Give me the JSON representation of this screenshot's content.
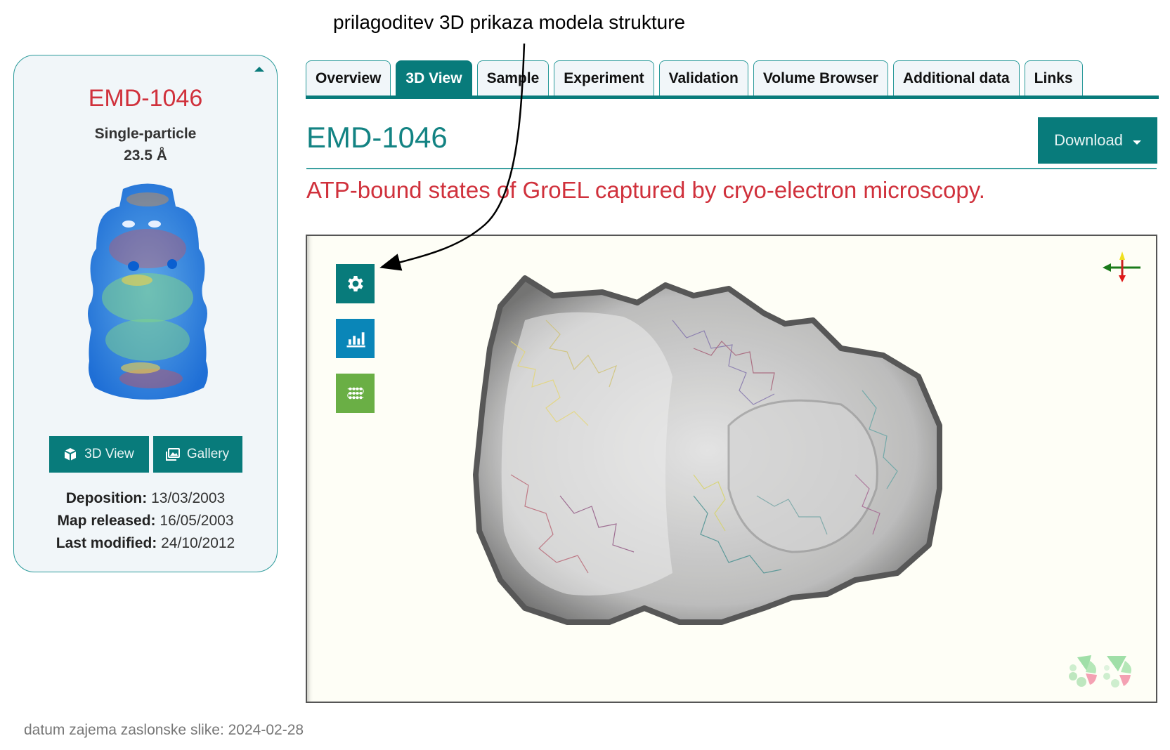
{
  "annotation": {
    "text": "prilagoditev 3D prikaza modela strukture"
  },
  "card": {
    "entry_id": "EMD-1046",
    "method": "Single-particle",
    "resolution": "23.5 Å",
    "buttons": [
      {
        "label": "3D View",
        "icon": "cube-icon"
      },
      {
        "label": "Gallery",
        "icon": "images-icon"
      }
    ],
    "meta": [
      {
        "label": "Deposition:",
        "value": "13/03/2003"
      },
      {
        "label": "Map released:",
        "value": "16/05/2003"
      },
      {
        "label": "Last modified:",
        "value": "24/10/2012"
      }
    ]
  },
  "tabs": [
    {
      "label": "Overview",
      "active": false
    },
    {
      "label": "3D View",
      "active": true
    },
    {
      "label": "Sample",
      "active": false
    },
    {
      "label": "Experiment",
      "active": false
    },
    {
      "label": "Validation",
      "active": false
    },
    {
      "label": "Volume Browser",
      "active": false
    },
    {
      "label": "Additional data",
      "active": false
    },
    {
      "label": "Links",
      "active": false
    }
  ],
  "header": {
    "title": "EMD-1046",
    "download_label": "Download",
    "entry_title": "ATP-bound states of GroEL captured by cryo-electron microscopy."
  },
  "viewer": {
    "buttons": [
      {
        "name": "settings",
        "icon": "gear-icon"
      },
      {
        "name": "stats",
        "icon": "bar-chart-icon"
      },
      {
        "name": "sequence",
        "icon": "sequence-icon"
      }
    ]
  },
  "colors": {
    "brand_teal": "#087b7b",
    "accent_red": "#d0313c",
    "stats_blue": "#0a86b8",
    "sequence_green": "#6aaf45",
    "viewer_bg": "#fefef6"
  },
  "footer": {
    "caption": "datum zajema zaslonske slike: 2024-02-28"
  }
}
